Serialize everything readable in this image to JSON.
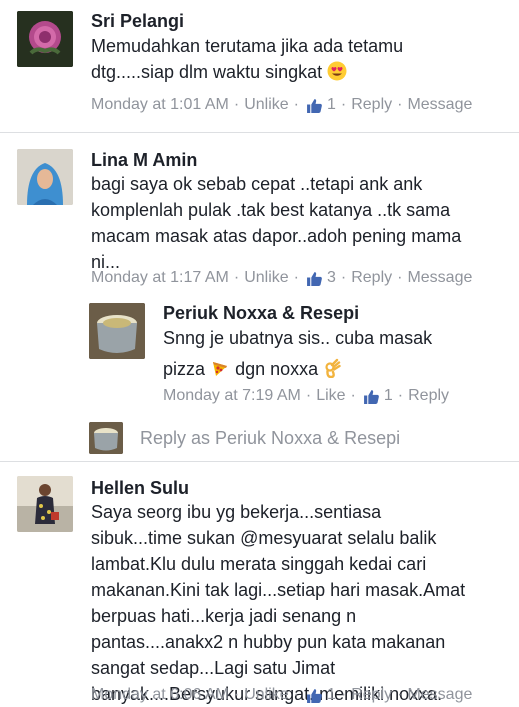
{
  "comments": [
    {
      "name": "Sri Pelangi",
      "text_lines": [
        "Memudahkan terutama jika ada tetamu",
        "dtg.....siap dlm waktu singkat"
      ],
      "time": "Monday at 1:01 AM",
      "action": "Unlike",
      "likes": "1",
      "reply": "Reply",
      "message": "Message"
    },
    {
      "name": "Lina M Amin",
      "text_lines": [
        "bagi saya ok sebab cepat ..tetapi ank ank",
        "komplenlah pulak .tak best katanya ..tk sama",
        "macam masak atas dapor..adoh pening mama",
        "ni..."
      ],
      "time": "Monday at 1:17 AM",
      "action": "Unlike",
      "likes": "3",
      "reply": "Reply",
      "message": "Message"
    },
    {
      "name": "Hellen Sulu",
      "text_lines": [
        "Saya seorg ibu yg bekerja...sentiasa",
        "sibuk...time sukan @mesyuarat selalu balik",
        "lambat.Klu dulu merata singgah kedai cari",
        "makanan.Kini tak lagi...setiap hari masak.Amat",
        "berpuas hati...kerja jadi senang n",
        "pantas....anakx2 n hubby pun kata makanan",
        "sangat sedap...Lagi satu Jimat",
        "banyak....Bersyukur sangat..memiliki noxxa."
      ],
      "time": "Monday at 6:06 AM",
      "action": "Unlike",
      "likes": "1",
      "reply": "Reply",
      "message": "Message"
    }
  ],
  "reply": {
    "name": "Periuk Noxxa & Resepi",
    "line1": "Snng je ubatnya sis.. cuba masak",
    "line2_a": "pizza",
    "line2_b": "dgn noxxa",
    "time": "Monday at 7:19 AM",
    "action": "Like",
    "likes": "1",
    "reply": "Reply"
  },
  "reply_as": "Reply as Periuk Noxxa & Resepi",
  "colors": {
    "meta": "#90949c",
    "like_blue": "#4267b2",
    "divider": "#dddfe2",
    "text": "#1d2129"
  },
  "icons": [
    "thumbs-up-icon",
    "heart-eyes-emoji",
    "pizza-emoji",
    "ok-hand-emoji"
  ]
}
